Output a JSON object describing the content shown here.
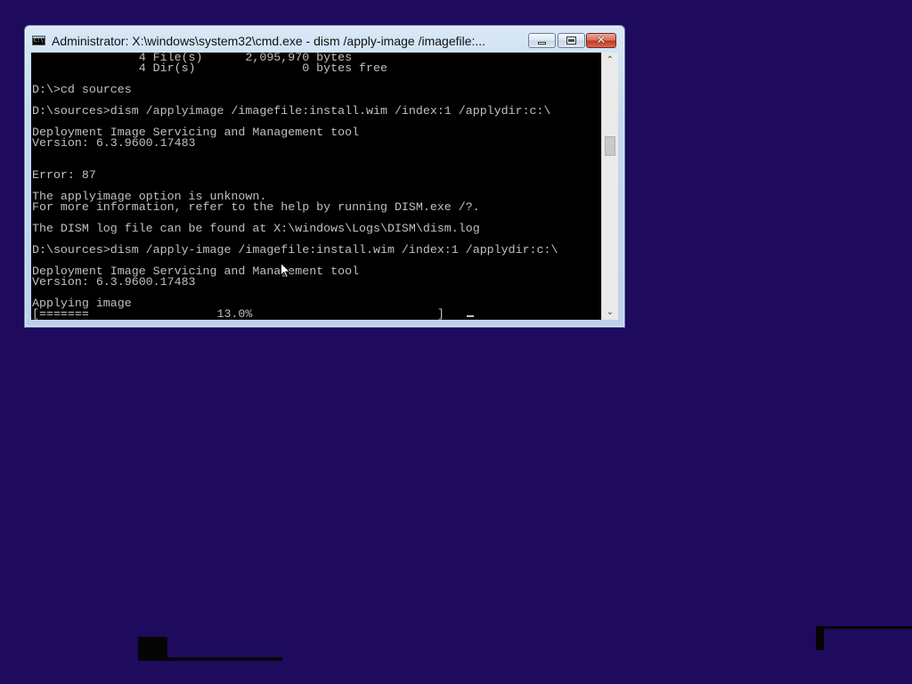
{
  "window": {
    "title": "Administrator: X:\\windows\\system32\\cmd.exe - dism  /apply-image /imagefile:...",
    "icon": "cmd-icon",
    "controls": {
      "minimize": "minimize-icon",
      "maximize": "maximize-icon",
      "close_glyph": "✕"
    }
  },
  "console": {
    "lines": [
      "               4 File(s)      2,095,970 bytes",
      "               4 Dir(s)               0 bytes free",
      "",
      "D:\\>cd sources",
      "",
      "D:\\sources>dism /applyimage /imagefile:install.wim /index:1 /applydir:c:\\",
      "",
      "Deployment Image Servicing and Management tool",
      "Version: 6.3.9600.17483",
      "",
      "",
      "Error: 87",
      "",
      "The applyimage option is unknown.",
      "For more information, refer to the help by running DISM.exe /?.",
      "",
      "The DISM log file can be found at X:\\windows\\Logs\\DISM\\dism.log",
      "",
      "D:\\sources>dism /apply-image /imagefile:install.wim /index:1 /applydir:c:\\",
      "",
      "Deployment Image Servicing and Management tool",
      "Version: 6.3.9600.17483",
      "",
      "Applying image",
      "[=======                  13.0%                          ]"
    ],
    "progress_percent": 13.0,
    "text_color": "#c0c0c0",
    "background_color": "#000000"
  },
  "scrollbar": {
    "up_arrow": "⌃",
    "down_arrow": "⌄"
  },
  "desktop": {
    "background_color": "#1e0b5e"
  }
}
